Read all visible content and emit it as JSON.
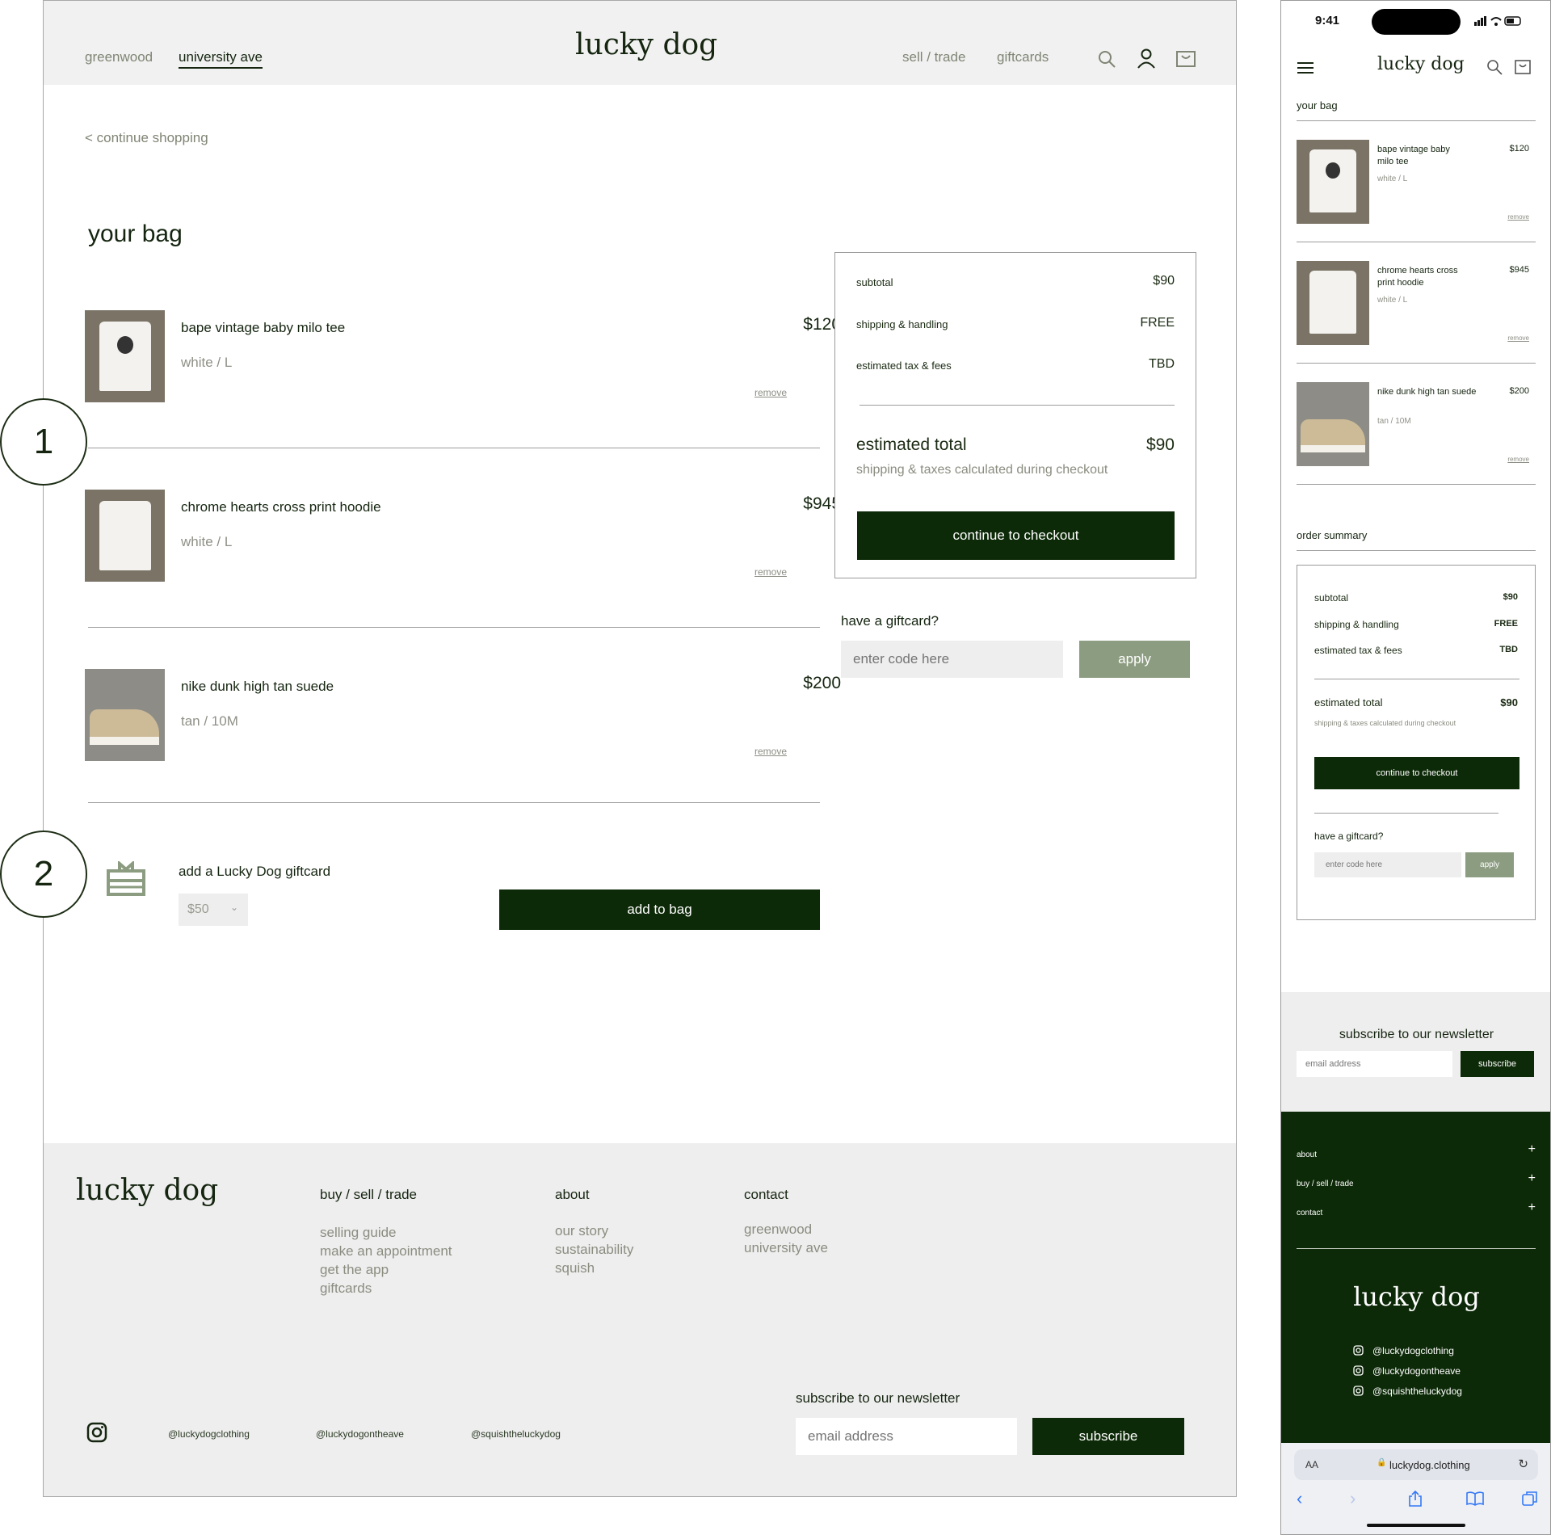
{
  "desktop": {
    "nav": {
      "location_1": "greenwood",
      "location_2": "university ave",
      "brand": "lucky dog",
      "sell_trade": "sell / trade",
      "giftcards": "giftcards"
    },
    "continue_shopping": "< continue shopping",
    "bag_title": "your bag",
    "items": [
      {
        "name": "bape vintage baby milo tee",
        "variant": "white / L",
        "price": "$120",
        "remove": "remove"
      },
      {
        "name": "chrome hearts cross print hoodie",
        "variant": "white / L",
        "price": "$945",
        "remove": "remove"
      },
      {
        "name": "nike dunk high tan suede",
        "variant": "tan / 10M",
        "price": "$200",
        "remove": "remove"
      }
    ],
    "summary": {
      "subtotal_label": "subtotal",
      "subtotal_value": "$90",
      "shipping_label": "shipping & handling",
      "shipping_value": "FREE",
      "tax_label": "estimated tax & fees",
      "tax_value": "TBD",
      "total_label": "estimated total",
      "total_value": "$90",
      "note": "shipping & taxes calculated during checkout",
      "checkout_button": "continue to checkout"
    },
    "giftcard": {
      "heading": "have a giftcard?",
      "placeholder": "enter code here",
      "apply": "apply"
    },
    "add_giftcard": {
      "label": "add a Lucky Dog giftcard",
      "amount": "$50",
      "button": "add to bag"
    },
    "annotations": [
      "1",
      "2"
    ],
    "footer": {
      "brand": "lucky dog",
      "col1_head": "buy / sell / trade",
      "col1_links": [
        "selling guide",
        "make an appointment",
        "get the app",
        "giftcards"
      ],
      "col2_head": "about",
      "col2_links": [
        "our story",
        "sustainability",
        "squish"
      ],
      "col3_head": "contact",
      "col3_links": [
        "greenwood",
        "university ave"
      ],
      "socials": [
        "@luckydogclothing",
        "@luckydogontheave",
        "@squishtheluckydog"
      ],
      "newsletter_heading": "subscribe to our newsletter",
      "email_placeholder": "email address",
      "subscribe": "subscribe"
    }
  },
  "mobile": {
    "status_time": "9:41",
    "brand": "lucky dog",
    "bag_title": "your bag",
    "items": [
      {
        "name": "bape vintage baby milo tee",
        "variant": "white / L",
        "price": "$120",
        "remove": "remove"
      },
      {
        "name": "chrome hearts cross print hoodie",
        "variant": "white / L",
        "price": "$945",
        "remove": "remove"
      },
      {
        "name": "nike dunk high tan suede",
        "variant": "tan / 10M",
        "price": "$200",
        "remove": "remove"
      }
    ],
    "summary_title": "order summary",
    "summary": {
      "subtotal_label": "subtotal",
      "subtotal_value": "$90",
      "shipping_label": "shipping & handling",
      "shipping_value": "FREE",
      "tax_label": "estimated tax & fees",
      "tax_value": "TBD",
      "total_label": "estimated total",
      "total_value": "$90",
      "note": "shipping & taxes calculated during checkout",
      "checkout_button": "continue to checkout"
    },
    "giftcard": {
      "heading": "have a giftcard?",
      "placeholder": "enter code here",
      "apply": "apply"
    },
    "newsletter": {
      "heading": "subscribe to our newsletter",
      "placeholder": "email address",
      "button": "subscribe"
    },
    "footer": {
      "accordion": [
        "about",
        "buy / sell / trade",
        "contact"
      ],
      "brand": "lucky dog",
      "socials": [
        "@luckydogclothing",
        "@luckydogontheave",
        "@squishtheluckydog"
      ]
    },
    "browser": {
      "text_size": "AA",
      "url": "luckydog.clothing"
    }
  },
  "colors": {
    "dark_green": "#0d2a08",
    "sage": "#8c9c80",
    "light_gray": "#f1f1f1"
  }
}
